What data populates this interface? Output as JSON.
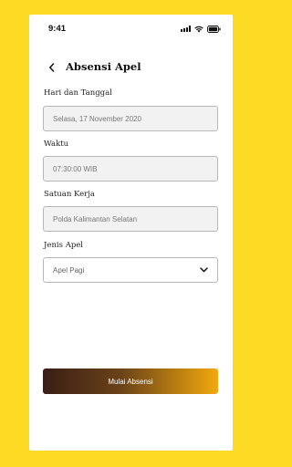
{
  "status_bar": {
    "time": "9:41"
  },
  "header": {
    "title": "Absensi Apel"
  },
  "form": {
    "date_label": "Hari dan Tanggal",
    "date_value": "Selasa, 17 November 2020",
    "time_label": "Waktu",
    "time_value": "07:30:00 WIB",
    "unit_label": "Satuan Kerja",
    "unit_value": "Polda Kalimantan Selatan",
    "type_label": "Jenis Apel",
    "type_value": "Apel Pagi"
  },
  "actions": {
    "start_label": "Mulai Absensi"
  },
  "colors": {
    "background": "#FDDA24",
    "button_start": "#3a1e16",
    "button_end": "#f2a90d"
  },
  "icons": {
    "back": "chevron-left-icon",
    "dropdown": "chevron-down-icon"
  }
}
